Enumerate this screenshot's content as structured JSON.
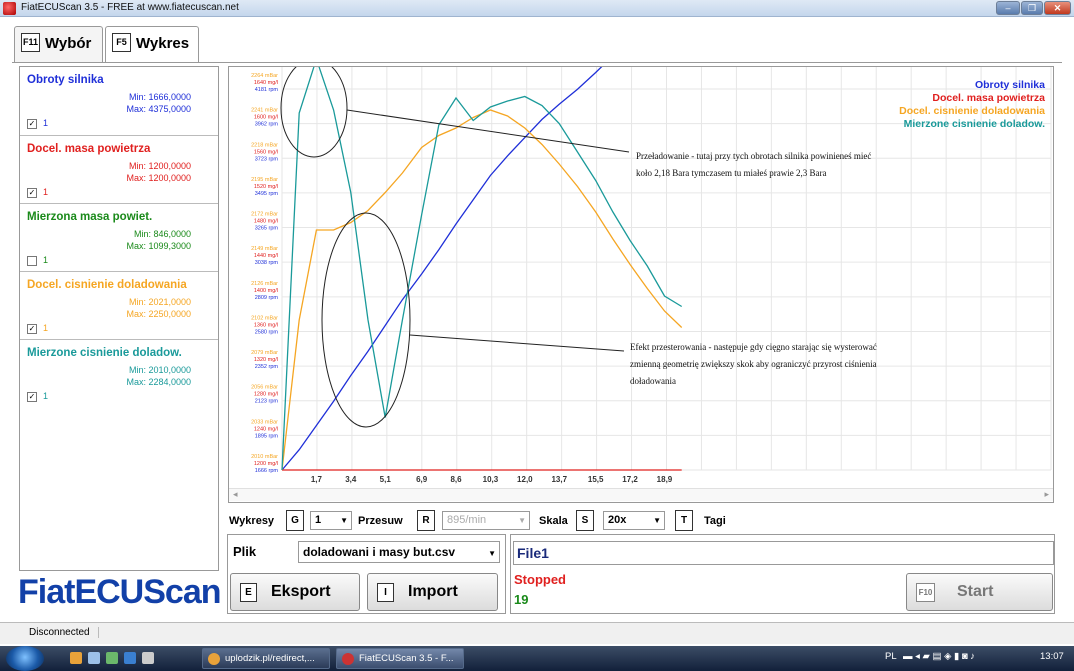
{
  "window": {
    "title": "FiatECUScan 3.5 - FREE at www.fiatecuscan.net"
  },
  "tabs": [
    {
      "key": "F11",
      "label": "Wybór"
    },
    {
      "key": "F5",
      "label": "Wykres"
    }
  ],
  "channels": [
    {
      "name": "Obroty silnika",
      "min": "Min: 1666,0000",
      "max": "Max: 4375,0000",
      "checked": true,
      "scale": "1",
      "color": "#1f2fd8"
    },
    {
      "name": "Docel. masa powietrza",
      "min": "Min: 1200,0000",
      "max": "Max: 1200,0000",
      "checked": true,
      "scale": "1",
      "color": "#e0201f"
    },
    {
      "name": "Mierzona masa powiet.",
      "min": "Min: 846,0000",
      "max": "Max: 1099,3000",
      "checked": false,
      "scale": "1",
      "color": "#1a8a1a"
    },
    {
      "name": "Docel. cisnienie doladowania",
      "min": "Min: 2021,0000",
      "max": "Max: 2250,0000",
      "checked": true,
      "scale": "1",
      "color": "#f5a623"
    },
    {
      "name": "Mierzone cisnienie doladow.",
      "min": "Min: 2010,0000",
      "max": "Max: 2284,0000",
      "checked": true,
      "scale": "1",
      "color": "#1a9a9a"
    }
  ],
  "logo": "FiatECUScan",
  "chart_data": {
    "type": "line",
    "x": [
      0,
      0.85,
      1.7,
      2.55,
      3.4,
      4.25,
      5.1,
      5.95,
      6.9,
      7.75,
      8.6,
      9.45,
      10.3,
      11.15,
      12.0,
      12.85,
      13.7,
      14.6,
      15.5,
      16.35,
      17.2,
      18.05,
      18.9,
      19.75
    ],
    "xticks": [
      "1,7",
      "3,4",
      "5,1",
      "6,9",
      "8,6",
      "10,3",
      "12,0",
      "13,7",
      "15,5",
      "17,2",
      "18,9"
    ],
    "xlim": [
      0,
      38
    ],
    "yaxis_labels": [
      [
        "2264 mBar",
        "1640 mg/l",
        "4181 rpm"
      ],
      [
        "2241 mBar",
        "1600 mg/l",
        "3962 rpm"
      ],
      [
        "2218 mBar",
        "1560 mg/l",
        "3723 rpm"
      ],
      [
        "2195 mBar",
        "1520 mg/l",
        "3495 rpm"
      ],
      [
        "2172 mBar",
        "1480 mg/l",
        "3265 rpm"
      ],
      [
        "2149 mBar",
        "1440 mg/l",
        "3038 rpm"
      ],
      [
        "2126 mBar",
        "1400 mg/l",
        "2809 rpm"
      ],
      [
        "2102 mBar",
        "1360 mg/l",
        "2580 rpm"
      ],
      [
        "2079 mBar",
        "1320 mg/l",
        "2352 rpm"
      ],
      [
        "2056 mBar",
        "1280 mg/l",
        "2123 rpm"
      ],
      [
        "2033 mBar",
        "1240 mg/l",
        "1895 rpm"
      ],
      [
        "2010 mBar",
        "1200 mg/l",
        "1666 rpm"
      ]
    ],
    "series": [
      {
        "name": "Obroty silnika",
        "color": "#1f2fd8",
        "values": [
          1666,
          1800,
          1960,
          2120,
          2290,
          2450,
          2620,
          2790,
          2960,
          3120,
          3290,
          3450,
          3610,
          3740,
          3860,
          3980,
          4080,
          4180,
          4290,
          4400,
          4520,
          4650,
          4790,
          4880
        ]
      },
      {
        "name": "Docel. masa powietrza",
        "color": "#e0201f",
        "values": [
          1200,
          1200,
          1200,
          1200,
          1200,
          1200,
          1200,
          1200,
          1200,
          1200,
          1200,
          1200,
          1200,
          1200,
          1200,
          1200,
          1200,
          1200,
          1200,
          1200,
          1200,
          1200,
          1200,
          1200
        ]
      },
      {
        "name": "Docel. cisnienie doladowania",
        "color": "#f5a623",
        "values": [
          2010,
          2110,
          2170,
          2170,
          2175,
          2183,
          2195,
          2208,
          2225,
          2233,
          2238,
          2245,
          2250,
          2246,
          2238,
          2227,
          2214,
          2199,
          2182,
          2164,
          2147,
          2131,
          2116,
          2105
        ]
      },
      {
        "name": "Mierzone cisnienie doladow.",
        "color": "#1a9a9a",
        "values": [
          2010,
          2248,
          2284,
          2250,
          2195,
          2110,
          2045,
          2110,
          2180,
          2240,
          2258,
          2243,
          2252,
          2256,
          2259,
          2253,
          2241,
          2222,
          2203,
          2182,
          2163,
          2146,
          2126,
          2119
        ]
      }
    ],
    "legend_placement": "top-right",
    "grid": true,
    "annotations": [
      {
        "lines": [
          "Przeładowanie - tutaj przy tych obrotach silnika powinieneś mieć",
          "koło 2,18 Bara tymczasem tu miałeś prawie 2,3 Bara"
        ]
      },
      {
        "lines": [
          "Efekt przesterowania - następuje gdy cięgno starając się wysterować",
          "zmienną geometrię zwiększy skok aby ograniczyć przyrost ciśnienia",
          "doładowania"
        ]
      }
    ]
  },
  "controls": {
    "wykresy_label": "Wykresy",
    "wykresy_key": "G",
    "wykresy_value": "1",
    "przesuw_label": "Przesuw",
    "przesuw_key": "R",
    "przesuw_value": "895/min",
    "skala_label": "Skala",
    "skala_key": "S",
    "skala_value": "20x",
    "tagi_key": "T",
    "tagi_label": "Tagi"
  },
  "file_panel": {
    "plik_label": "Plik",
    "plik_value": "doladowani i masy but.csv",
    "eksport_key": "E",
    "eksport_label": "Eksport",
    "import_key": "I",
    "import_label": "Import"
  },
  "run_panel": {
    "file_name": "File1",
    "status": "Stopped",
    "count": "19",
    "start_key": "F10",
    "start_label": "Start"
  },
  "statusbar": {
    "connection": "Disconnected"
  },
  "taskbar": {
    "tasks": [
      "uplodzik.pl/redirect,...",
      "FiatECUScan 3.5 - F..."
    ],
    "lang": "PL",
    "time": "13:07"
  }
}
